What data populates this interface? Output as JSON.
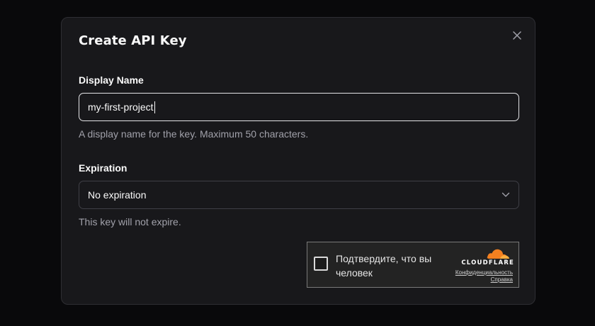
{
  "dialog": {
    "title": "Create API Key",
    "close_icon": "close-icon"
  },
  "display_name": {
    "label": "Display Name",
    "value": "my-first-project",
    "hint": "A display name for the key. Maximum 50 characters."
  },
  "expiration": {
    "label": "Expiration",
    "selected": "No expiration",
    "dropdown_icon": "chevron-down-icon",
    "hint": "This key will not expire."
  },
  "captcha": {
    "prompt": "Подтвердите, что вы человек",
    "brand": "CLOUDFLARE",
    "privacy_link": "Конфиденциальность",
    "help_link": "Справка",
    "brand_color": "#f38020"
  }
}
